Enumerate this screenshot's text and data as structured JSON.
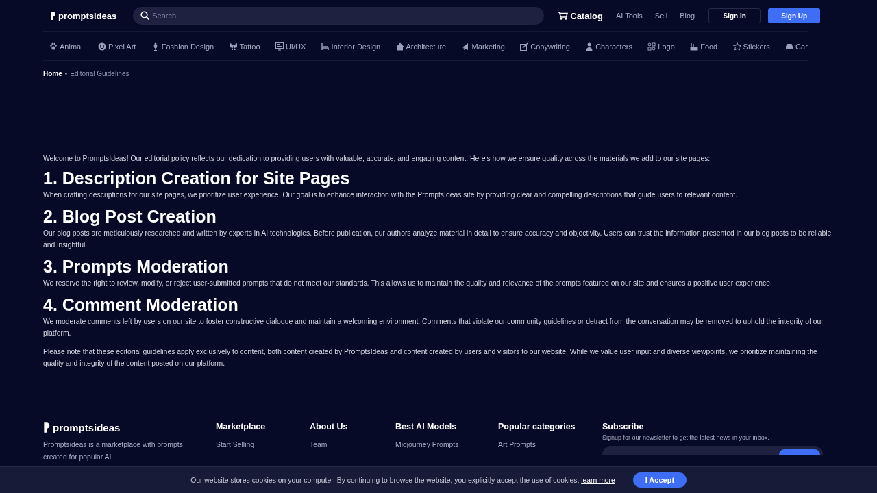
{
  "header": {
    "logo": "promptsideas",
    "search": {
      "placeholder": "Search"
    },
    "links": [
      {
        "label": "Catalog",
        "kind": "catalog"
      },
      {
        "label": "AI Tools",
        "kind": "plain"
      },
      {
        "label": "Sell",
        "kind": "plain"
      },
      {
        "label": "Blog",
        "kind": "plain"
      }
    ],
    "buttons": [
      {
        "label": "Sign In",
        "kind": "outline"
      },
      {
        "label": "Sign Up",
        "kind": "primary"
      }
    ]
  },
  "categories": [
    {
      "label": "Animal"
    },
    {
      "label": "Pixel Art"
    },
    {
      "label": "Fashion Design"
    },
    {
      "label": "Tattoo"
    },
    {
      "label": "UI/UX"
    },
    {
      "label": "Interior Design"
    },
    {
      "label": "Architecture"
    },
    {
      "label": "Marketing"
    },
    {
      "label": "Copywriting"
    },
    {
      "label": "Characters"
    },
    {
      "label": "Logo"
    },
    {
      "label": "Food"
    },
    {
      "label": "Stickers"
    },
    {
      "label": "Car"
    }
  ],
  "breadcrumb": {
    "separator": "•",
    "items": [
      {
        "label": "Home",
        "current": false
      },
      {
        "label": "Editorial Guidelines",
        "current": true
      }
    ]
  },
  "intro": "Welcome to PromptsIdeas! Our editorial policy reflects our dedication to providing users with valuable, accurate, and engaging content. Here's how we ensure quality across the materials we add to our site pages:",
  "sections": [
    {
      "heading": "1. Description Creation for Site Pages",
      "text": "When crafting descriptions for our site pages, we prioritize user experience. Our goal is to enhance interaction with the PromptsIdeas site by providing clear and compelling descriptions that guide users to relevant content."
    },
    {
      "heading": "2. Blog Post Creation",
      "text": "Our blog posts are meticulously researched and written by experts in AI technologies. Before publication, our authors analyze material in detail to ensure accuracy and objectivity. Users can trust the information presented in our blog posts to be reliable and insightful."
    },
    {
      "heading": "3. Prompts Moderation",
      "text": "We reserve the right to review, modify, or reject user-submitted prompts that do not meet our standards. This allows us to maintain the quality and relevance of the prompts featured on our site and ensures a positive user experience."
    },
    {
      "heading": "4. Comment Moderation",
      "text": "We moderate comments left by users on our site to foster constructive dialogue and maintain a welcoming environment. Comments that violate our community guidelines or detract from the conversation may be removed to uphold the integrity of our platform."
    }
  ],
  "closing": "Please note that these editorial guidelines apply exclusively to content, both content created by PromptsIdeas and content created by users and visitors to our website. While we value user input and diverse viewpoints, we prioritize maintaining the quality and integrity of the content posted on our platform.",
  "footer": {
    "logo": "promptsideas",
    "description": "Promptsideas is a marketplace with prompts created for popular AI",
    "columns": [
      {
        "title": "Marketplace",
        "links": [
          "Start Selling"
        ]
      },
      {
        "title": "About Us",
        "links": [
          "Team"
        ]
      },
      {
        "title": "Best AI Models",
        "links": [
          "Midjourney Prompts"
        ]
      },
      {
        "title": "Popular categories",
        "links": [
          "Art Prompts"
        ]
      }
    ],
    "subscribe": {
      "title": "Subscribe",
      "text": "Signup for our newsletter to get the latest news in your inbox."
    }
  },
  "cookie_banner": {
    "text": "Our website stores cookies on your computer. By continuing to browse the website, you explicitly accept the use of cookies,",
    "link": "learn more",
    "button": "I Accept"
  }
}
